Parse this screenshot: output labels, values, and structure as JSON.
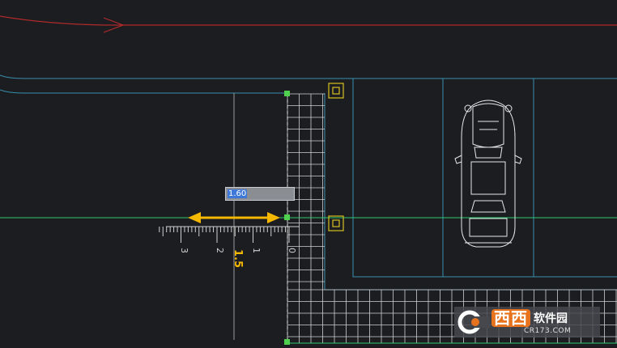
{
  "tool": {
    "length_input_selected": "1.60",
    "length_label": "1.5"
  },
  "ruler": {
    "tick_labels": [
      "3",
      "2",
      "1",
      "0"
    ]
  },
  "watermark": {
    "brand": "西西",
    "name": "软件园",
    "url": "CR173.COM"
  },
  "colors": {
    "background": "#1c1d21",
    "wall": "#3a8fb0",
    "grid": "#d8d8d8",
    "guide_green": "#2ecc71",
    "arrow_red": "#b02a2a",
    "measure_arrow": "#f5b800",
    "handle": "#4fd14f",
    "snap_box": "#d8c020"
  },
  "icons": {
    "vehicle": "car-icon",
    "snap": "snap-square-icon",
    "handle": "endpoint-handle-icon"
  }
}
